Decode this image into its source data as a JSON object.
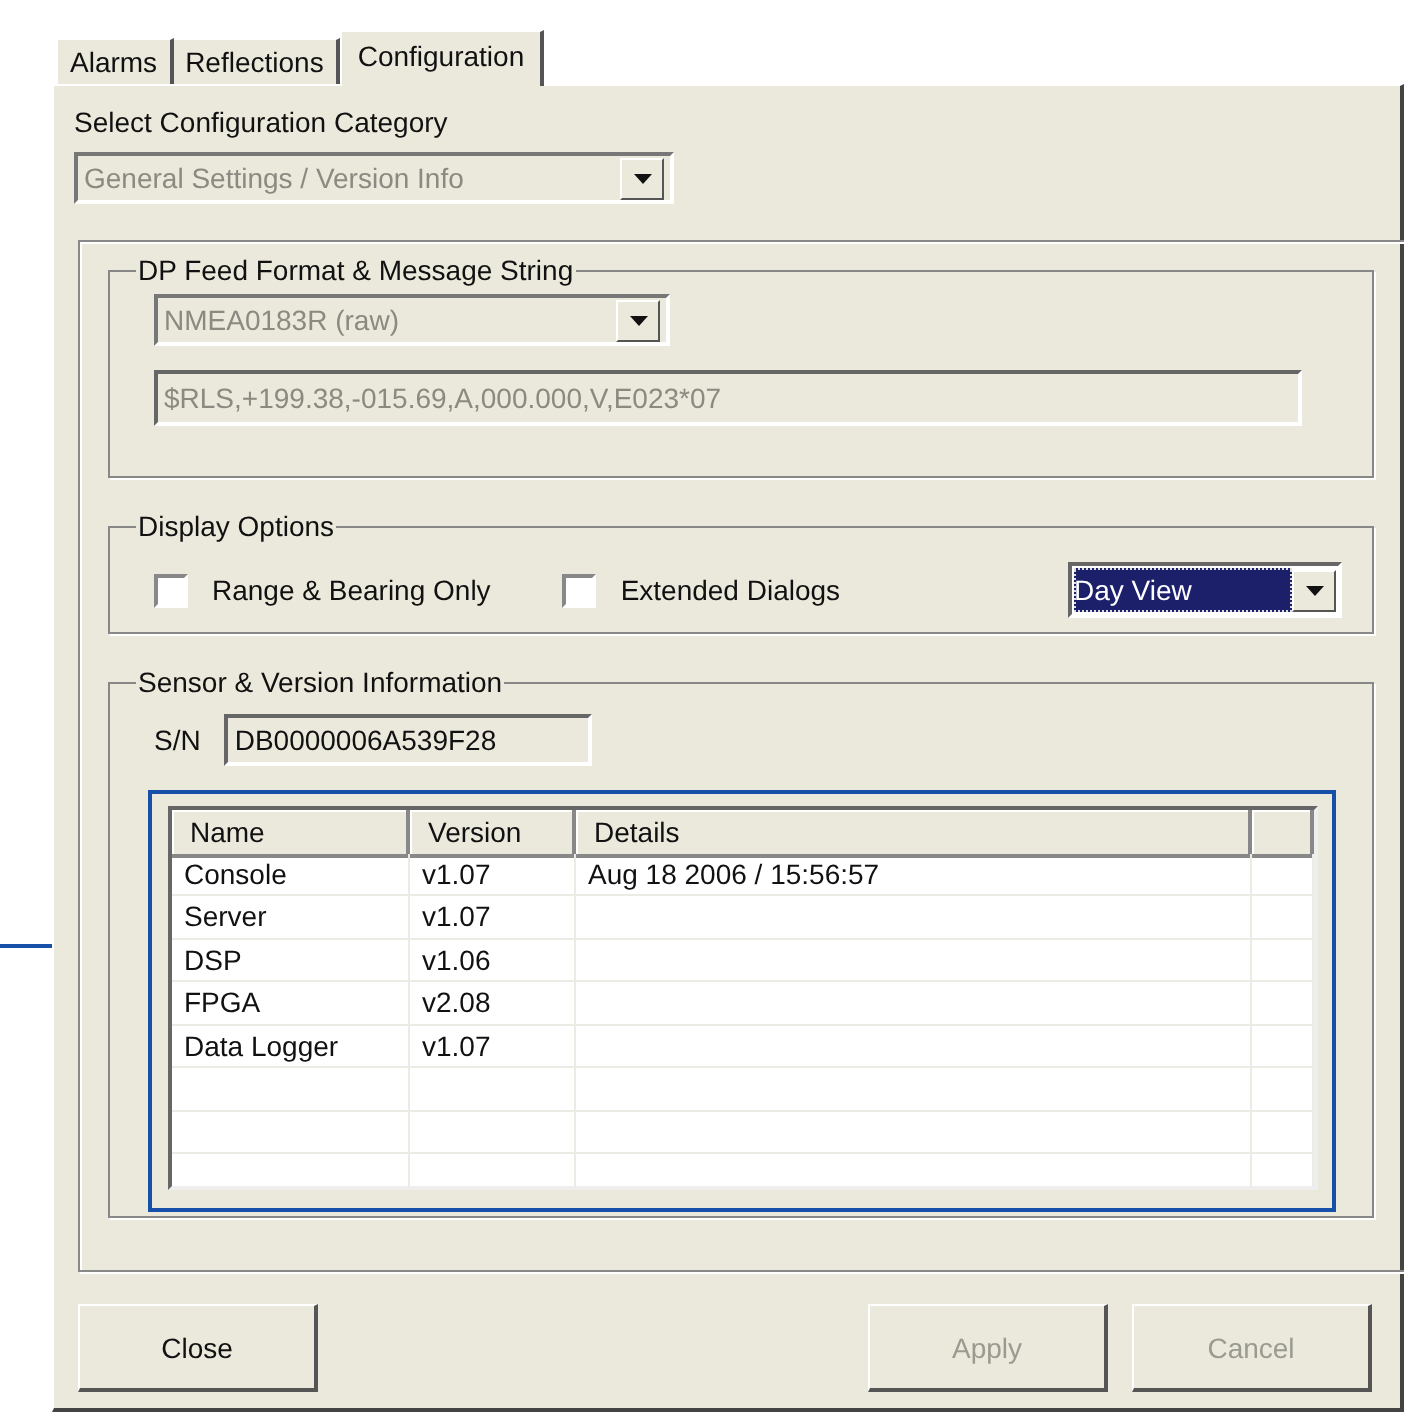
{
  "tabs": [
    {
      "label": "Alarms",
      "selected": false
    },
    {
      "label": "Reflections",
      "selected": false
    },
    {
      "label": "Configuration",
      "selected": true
    }
  ],
  "category": {
    "label": "Select Configuration Category",
    "value": "General Settings / Version Info",
    "disabled": true
  },
  "feed_group": {
    "title": "DP Feed Format & Message String",
    "format": {
      "value": "NMEA0183R (raw)",
      "disabled": true
    },
    "message": {
      "value": "$RLS,+199.38,-015.69,A,000.000,V,E023*07",
      "disabled": true
    }
  },
  "display_group": {
    "title": "Display Options",
    "checkboxes": [
      {
        "label": "Range & Bearing Only",
        "checked": false
      },
      {
        "label": "Extended Dialogs",
        "checked": false
      }
    ],
    "view": {
      "value": "Day View",
      "focused": true
    }
  },
  "sensor_group": {
    "title": "Sensor & Version Information",
    "serial_label": "S/N",
    "serial": "DB0000006A539F28",
    "table": {
      "columns": [
        "Name",
        "Version",
        "Details"
      ],
      "rows": [
        [
          "Console",
          "v1.07",
          "Aug 18 2006 / 15:56:57"
        ],
        [
          "Server",
          "v1.07",
          ""
        ],
        [
          "DSP",
          "v1.06",
          ""
        ],
        [
          "FPGA",
          "v2.08",
          ""
        ],
        [
          "Data Logger",
          "v1.07",
          ""
        ]
      ]
    }
  },
  "buttons": [
    {
      "label": "Close",
      "disabled": false
    },
    {
      "label": "Apply",
      "disabled": true
    },
    {
      "label": "Cancel",
      "disabled": true
    }
  ]
}
